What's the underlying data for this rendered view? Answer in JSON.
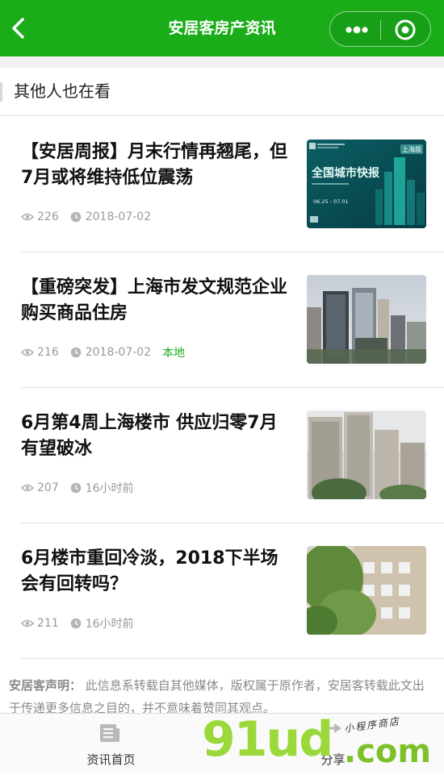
{
  "header": {
    "title": "安居客房产资讯",
    "brand_color": "#1aad19"
  },
  "section": {
    "title": "其他人也在看"
  },
  "articles": [
    {
      "title": "【安居周报】月末行情再翘尾，但7月或将维持低位震荡",
      "views": "226",
      "date": "2018-07-02",
      "tag": "",
      "thumb_banner": "全国城市快报",
      "thumb_badge": "上海版",
      "thumb_dates": "06.25 - 07.01"
    },
    {
      "title": "【重磅突发】上海市发文规范企业购买商品住房",
      "views": "216",
      "date": "2018-07-02",
      "tag": "本地"
    },
    {
      "title": "6月第4周上海楼市 供应归零7月有望破冰",
      "views": "207",
      "date": "16小时前",
      "tag": ""
    },
    {
      "title": "6月楼市重回冷淡，2018下半场会有回转吗？",
      "views": "211",
      "date": "16小时前",
      "tag": ""
    }
  ],
  "disclaimer": {
    "label": "安居客声明：",
    "text": "此信息系转载自其他媒体，版权属于原作者，安居客转载此文出于传递更多信息之目的，并不意味着赞同其观点。"
  },
  "tabs": [
    {
      "label": "资讯首页",
      "icon": "news-icon"
    },
    {
      "label": "分享",
      "icon": "share-icon"
    }
  ],
  "watermark": {
    "big": "91ud",
    "com": ".com",
    "small": "小程序商店"
  }
}
